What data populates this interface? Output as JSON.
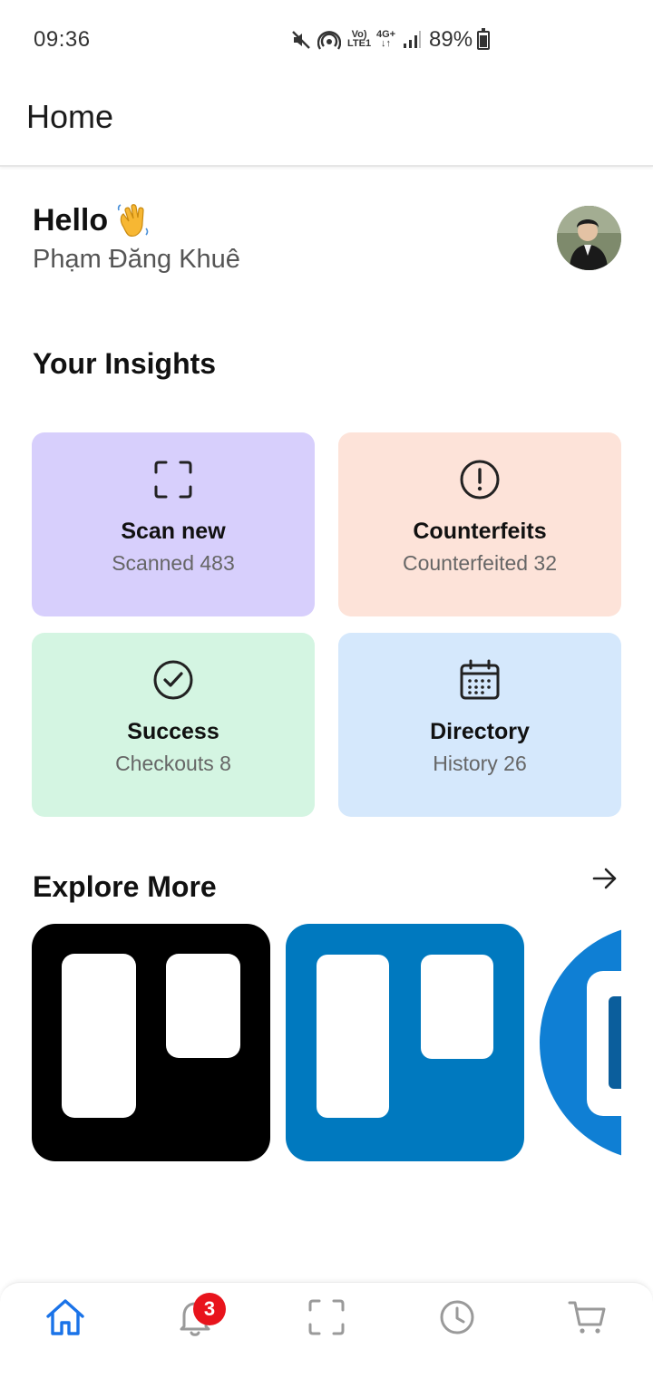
{
  "status_bar": {
    "time": "09:36",
    "battery_percent": "89%",
    "net_label_top": "Vo)",
    "net_label_bottom": "LTE1",
    "data_label": "4G+",
    "icons": [
      "mute-icon",
      "hotspot-icon",
      "signal-icon",
      "battery-icon"
    ]
  },
  "app_bar": {
    "title": "Home"
  },
  "greeting": {
    "hello": "Hello",
    "emoji_icon": "waving-hand-icon",
    "name": "Phạm Đăng Khuê"
  },
  "insights": {
    "title": "Your Insights",
    "cards": [
      {
        "title": "Scan new",
        "subtitle": "Scanned 483",
        "icon": "scan-frame-icon",
        "color": "#d7cffc"
      },
      {
        "title": "Counterfeits",
        "subtitle": "Counterfeited 32",
        "icon": "alert-circle-icon",
        "color": "#fde3d9"
      },
      {
        "title": "Success",
        "subtitle": "Checkouts 8",
        "icon": "check-circle-icon",
        "color": "#d4f5e2"
      },
      {
        "title": "Directory",
        "subtitle": "History 26",
        "icon": "calendar-icon",
        "color": "#d5e8fc"
      }
    ]
  },
  "explore": {
    "title": "Explore More",
    "arrow_icon": "arrow-right-icon",
    "tiles": [
      {
        "icon": "trello-logo-black",
        "color": "#000000"
      },
      {
        "icon": "trello-logo-blue",
        "color": "#0079bf"
      },
      {
        "icon": "app-logo-blue",
        "color": "#0f7fd4"
      }
    ]
  },
  "bottom_nav": {
    "items": [
      "home-icon",
      "bell-icon",
      "scan-icon",
      "clock-icon",
      "cart-icon"
    ],
    "active": "home-icon",
    "notification_count": "3",
    "accent": "#1a73e8"
  }
}
